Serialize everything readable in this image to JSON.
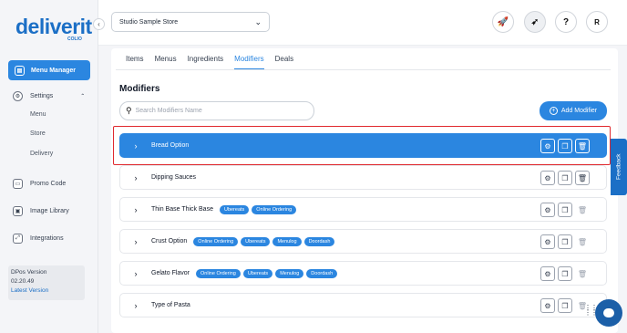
{
  "brand": {
    "name": "deliverit",
    "sub": "COLIO"
  },
  "sidebar": {
    "active": "Menu Manager",
    "settings": "Settings",
    "sub_items": [
      "Menu",
      "Store",
      "Delivery"
    ],
    "items": [
      "Promo Code",
      "Image Library",
      "Integrations"
    ],
    "version_label": "DPos Version",
    "version_number": "02.20.49",
    "version_link": "Latest Version"
  },
  "topbar": {
    "store": "Studio Sample Store",
    "user_initial": "R",
    "help": "?"
  },
  "tabs": [
    {
      "label": "Items"
    },
    {
      "label": "Menus"
    },
    {
      "label": "Ingredients"
    },
    {
      "label": "Modifiers"
    },
    {
      "label": "Deals"
    }
  ],
  "page": {
    "heading": "Modifiers",
    "search_placeholder": "Search Modifiers Name",
    "add_button": "Add Modifier"
  },
  "modifiers": [
    {
      "name": "Bread Option",
      "tags": []
    },
    {
      "name": "Dipping Sauces",
      "tags": []
    },
    {
      "name": "Thin Base Thick Base",
      "tags": [
        "Ubereats",
        "Online Ordering"
      ]
    },
    {
      "name": "Crust Option",
      "tags": [
        "Online Ordering",
        "Ubereats",
        "Menulog",
        "Doordash"
      ]
    },
    {
      "name": "Gelato Flavor",
      "tags": [
        "Online Ordering",
        "Ubereats",
        "Menulog",
        "Doordash"
      ]
    },
    {
      "name": "Type of Pasta",
      "tags": []
    }
  ],
  "feedback": "Feedback",
  "colors": {
    "accent": "#2b86e0",
    "brand": "#1b6fc6",
    "highlight": "#e0292f"
  }
}
